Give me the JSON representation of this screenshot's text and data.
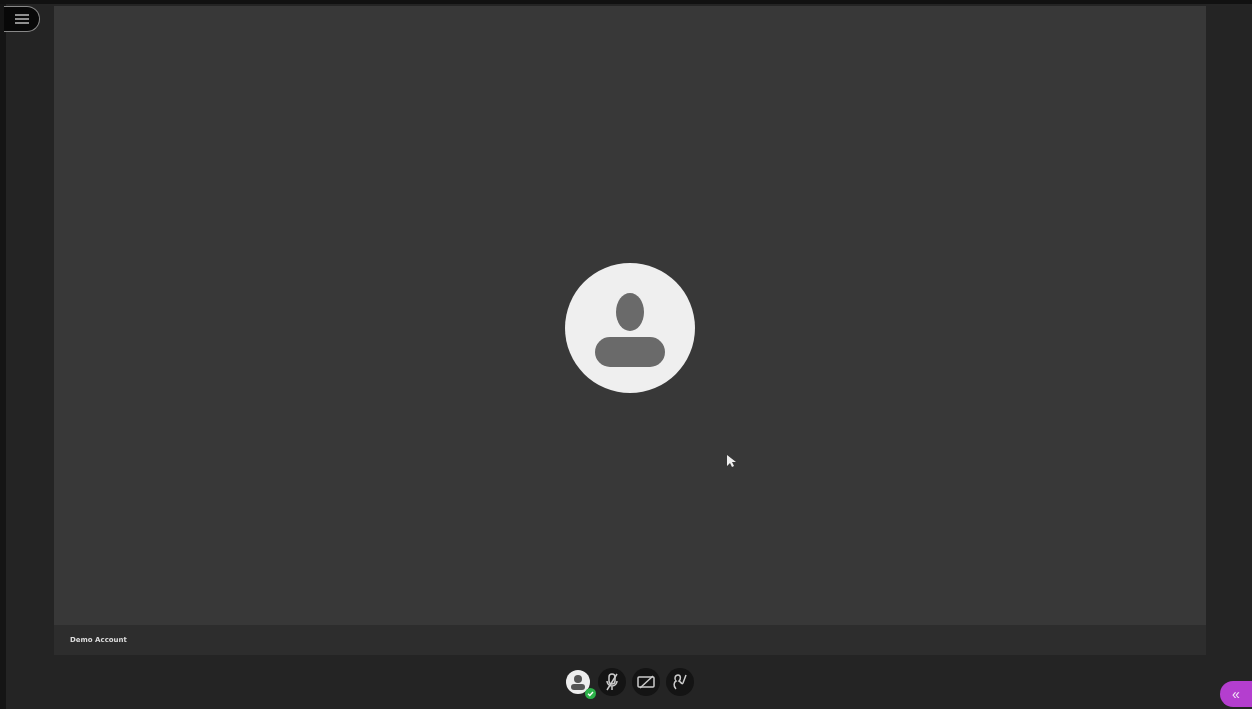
{
  "participant": {
    "name": "Demo Account"
  },
  "controls": [
    {
      "kind": "user"
    },
    {
      "kind": "mic",
      "muted": true
    },
    {
      "kind": "camera",
      "muted": true
    },
    {
      "kind": "hand"
    }
  ],
  "side_toggle": {
    "label": "«"
  }
}
